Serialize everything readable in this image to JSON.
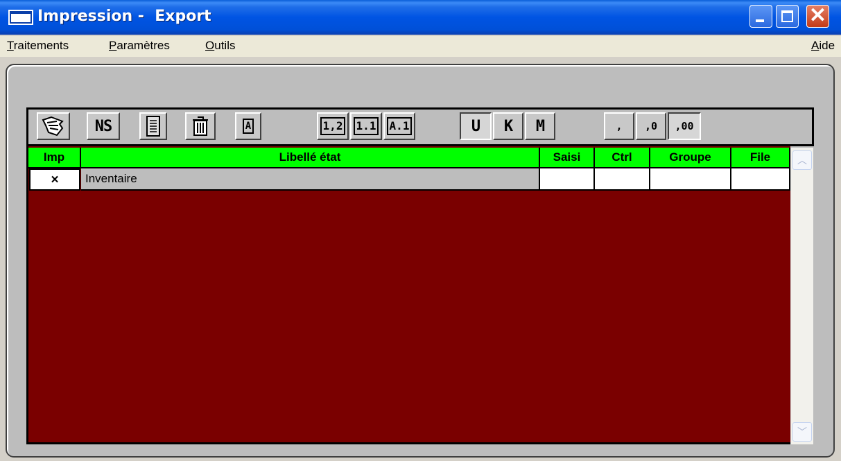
{
  "window": {
    "title": "Impression -  Export",
    "controls": {
      "minimize": "minimize",
      "maximize": "maximize",
      "close": "✕"
    }
  },
  "menu": {
    "items": [
      {
        "first": "T",
        "rest": "raitements"
      },
      {
        "first": "P",
        "rest": "aramètres"
      },
      {
        "first": "O",
        "rest": "utils"
      }
    ],
    "help": {
      "first": "A",
      "rest": "ide"
    }
  },
  "toolbar": {
    "buttons": [
      {
        "name": "hand-icon",
        "label": ""
      },
      {
        "name": "ns-button",
        "label": "NS"
      },
      {
        "name": "document-icon",
        "label": ""
      },
      {
        "name": "trash-icon",
        "label": ""
      },
      {
        "name": "font-icon",
        "label": "A"
      },
      {
        "name": "format-1-2-button",
        "label": "1,2"
      },
      {
        "name": "format-1-1-button",
        "label": "1.1"
      },
      {
        "name": "format-a1-button",
        "label": "A.1"
      },
      {
        "name": "unit-u-button",
        "label": "U"
      },
      {
        "name": "unit-k-button",
        "label": "K"
      },
      {
        "name": "unit-m-button",
        "label": "M"
      },
      {
        "name": "decimal-none-button",
        "label": ","
      },
      {
        "name": "decimal-0-button",
        "label": ",0"
      },
      {
        "name": "decimal-00-button",
        "label": ",00"
      }
    ]
  },
  "table": {
    "columns": [
      "Imp",
      "Libellé état",
      "Saisi",
      "Ctrl",
      "Groupe",
      "File"
    ],
    "rows": [
      {
        "imp": "×",
        "libelle": "Inventaire",
        "saisi": "",
        "ctrl": "",
        "groupe": "",
        "file": ""
      }
    ]
  },
  "colors": {
    "header_bg": "#00ff00",
    "grid_bg": "#7a0000",
    "titlebar": "#0054e3"
  }
}
